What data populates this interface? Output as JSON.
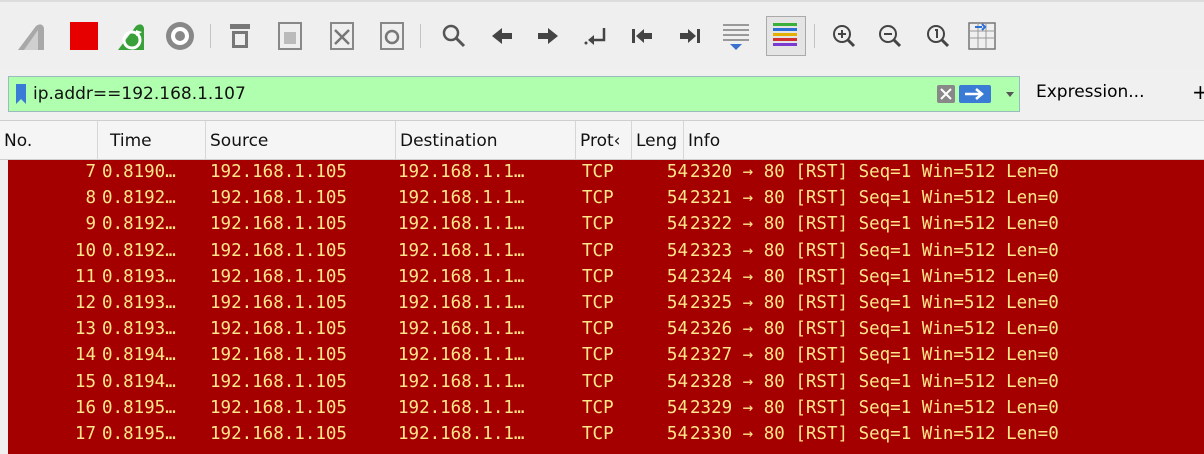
{
  "toolbar": {
    "buttons": [
      {
        "name": "start-capture-icon"
      },
      {
        "name": "stop-capture-icon"
      },
      {
        "name": "restart-capture-icon"
      },
      {
        "name": "capture-options-icon"
      },
      {
        "name": "open-file-icon"
      },
      {
        "name": "save-file-icon"
      },
      {
        "name": "close-file-icon"
      },
      {
        "name": "reload-file-icon"
      },
      {
        "name": "find-packet-icon"
      },
      {
        "name": "go-back-icon"
      },
      {
        "name": "go-forward-icon"
      },
      {
        "name": "go-to-packet-icon"
      },
      {
        "name": "go-first-packet-icon"
      },
      {
        "name": "go-last-packet-icon"
      },
      {
        "name": "autoscroll-icon"
      },
      {
        "name": "colorize-icon"
      },
      {
        "name": "zoom-in-icon"
      },
      {
        "name": "zoom-out-icon"
      },
      {
        "name": "normal-size-icon"
      },
      {
        "name": "resize-columns-icon"
      }
    ]
  },
  "filter": {
    "value": "ip.addr==192.168.1.107",
    "expression_label": "Expression...",
    "add_label": "+",
    "valid_color": "#afffaf"
  },
  "columns": [
    "No.",
    "Time",
    "Source",
    "Destination",
    "Protocol",
    "Length",
    "Info"
  ],
  "header_display": [
    "No.",
    "Time",
    "Source",
    "Destination",
    "Prot‹",
    "Leng",
    "Info"
  ],
  "row_colors": {
    "background": "#a40000",
    "foreground": "#ffe68a"
  },
  "packets": [
    {
      "no": "7",
      "time": "0.8190…",
      "src": "192.168.1.105",
      "dst": "192.168.1.1…",
      "proto": "TCP",
      "len": "54",
      "info": "2320 → 80 [RST] Seq=1 Win=512 Len=0"
    },
    {
      "no": "8",
      "time": "0.8192…",
      "src": "192.168.1.105",
      "dst": "192.168.1.1…",
      "proto": "TCP",
      "len": "54",
      "info": "2321 → 80 [RST] Seq=1 Win=512 Len=0"
    },
    {
      "no": "9",
      "time": "0.8192…",
      "src": "192.168.1.105",
      "dst": "192.168.1.1…",
      "proto": "TCP",
      "len": "54",
      "info": "2322 → 80 [RST] Seq=1 Win=512 Len=0"
    },
    {
      "no": "10",
      "time": "0.8192…",
      "src": "192.168.1.105",
      "dst": "192.168.1.1…",
      "proto": "TCP",
      "len": "54",
      "info": "2323 → 80 [RST] Seq=1 Win=512 Len=0"
    },
    {
      "no": "11",
      "time": "0.8193…",
      "src": "192.168.1.105",
      "dst": "192.168.1.1…",
      "proto": "TCP",
      "len": "54",
      "info": "2324 → 80 [RST] Seq=1 Win=512 Len=0"
    },
    {
      "no": "12",
      "time": "0.8193…",
      "src": "192.168.1.105",
      "dst": "192.168.1.1…",
      "proto": "TCP",
      "len": "54",
      "info": "2325 → 80 [RST] Seq=1 Win=512 Len=0"
    },
    {
      "no": "13",
      "time": "0.8193…",
      "src": "192.168.1.105",
      "dst": "192.168.1.1…",
      "proto": "TCP",
      "len": "54",
      "info": "2326 → 80 [RST] Seq=1 Win=512 Len=0"
    },
    {
      "no": "14",
      "time": "0.8194…",
      "src": "192.168.1.105",
      "dst": "192.168.1.1…",
      "proto": "TCP",
      "len": "54",
      "info": "2327 → 80 [RST] Seq=1 Win=512 Len=0"
    },
    {
      "no": "15",
      "time": "0.8194…",
      "src": "192.168.1.105",
      "dst": "192.168.1.1…",
      "proto": "TCP",
      "len": "54",
      "info": "2328 → 80 [RST] Seq=1 Win=512 Len=0"
    },
    {
      "no": "16",
      "time": "0.8195…",
      "src": "192.168.1.105",
      "dst": "192.168.1.1…",
      "proto": "TCP",
      "len": "54",
      "info": "2329 → 80 [RST] Seq=1 Win=512 Len=0"
    },
    {
      "no": "17",
      "time": "0.8195…",
      "src": "192.168.1.105",
      "dst": "192.168.1.1…",
      "proto": "TCP",
      "len": "54",
      "info": "2330 → 80 [RST] Seq=1 Win=512 Len=0"
    }
  ]
}
